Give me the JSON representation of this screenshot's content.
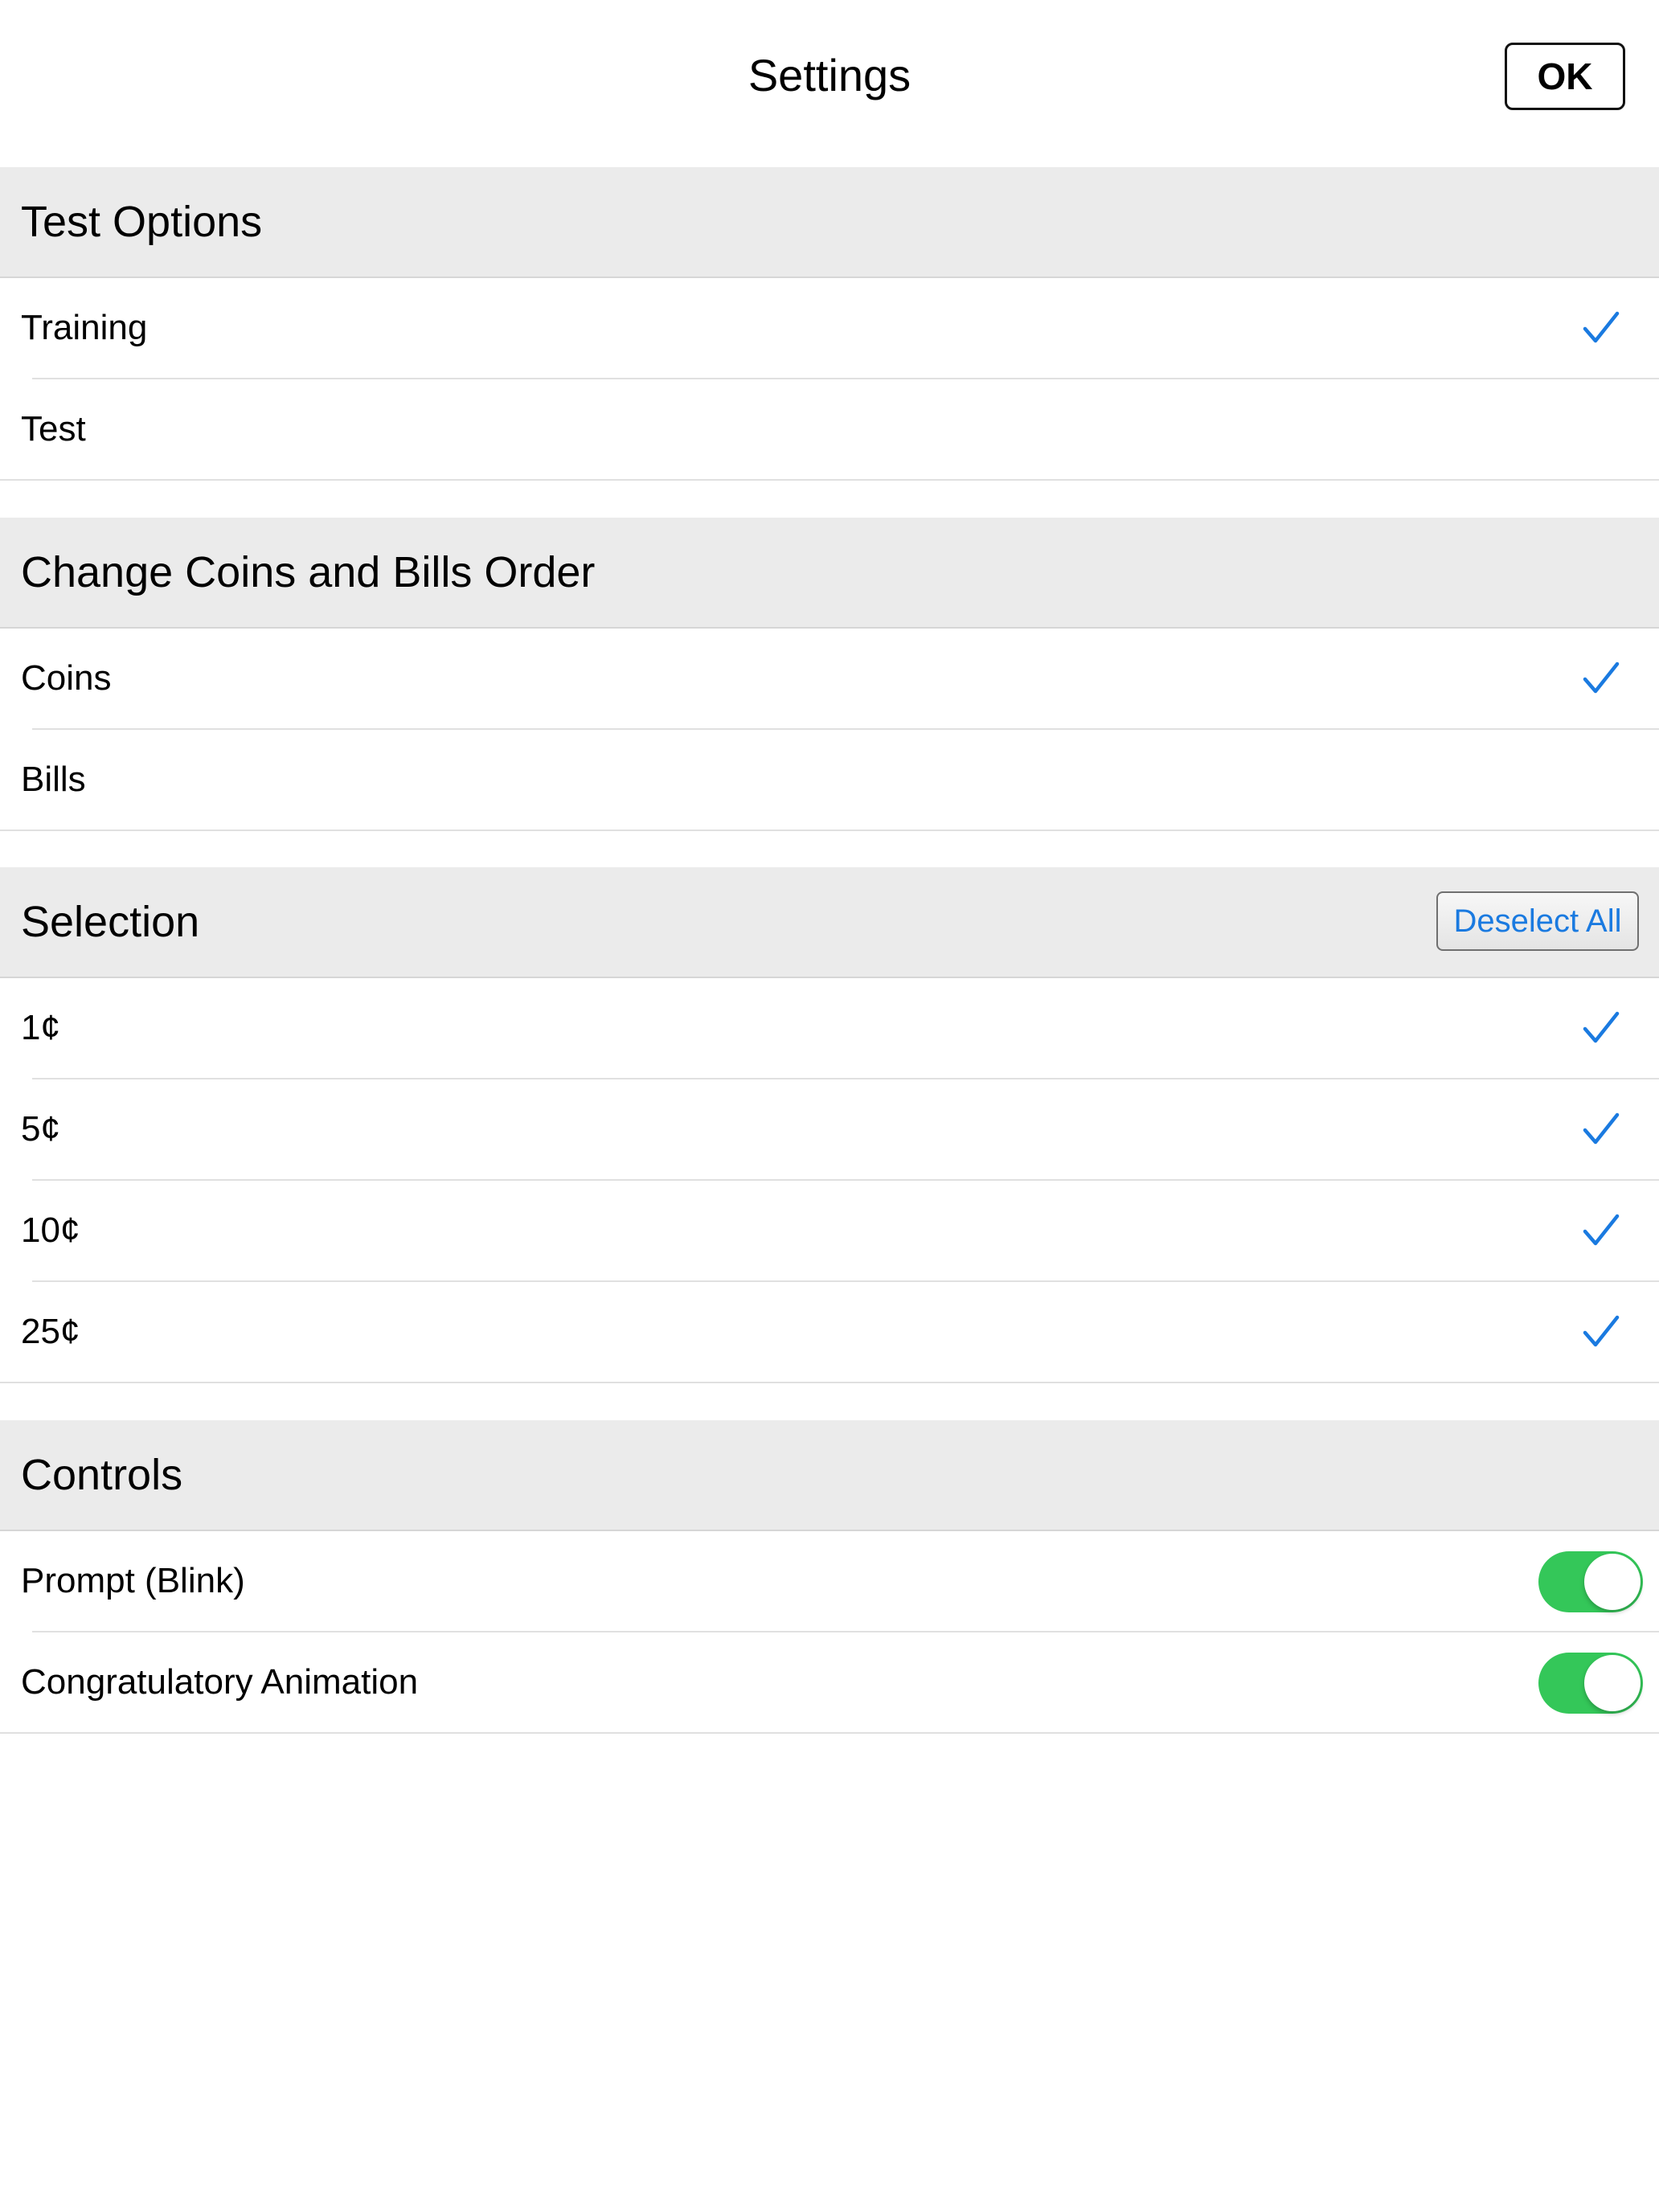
{
  "header": {
    "title": "Settings",
    "ok_label": "OK"
  },
  "sections": {
    "test_options": {
      "title": "Test Options",
      "rows": [
        {
          "label": "Training",
          "checked": true
        },
        {
          "label": "Test",
          "checked": false
        }
      ]
    },
    "order": {
      "title": "Change Coins and Bills Order",
      "rows": [
        {
          "label": "Coins",
          "checked": true
        },
        {
          "label": "Bills",
          "checked": false
        }
      ]
    },
    "selection": {
      "title": "Selection",
      "deselect_label": "Deselect All",
      "rows": [
        {
          "label": "1¢",
          "checked": true
        },
        {
          "label": "5¢",
          "checked": true
        },
        {
          "label": "10¢",
          "checked": true
        },
        {
          "label": "25¢",
          "checked": true
        }
      ]
    },
    "controls": {
      "title": "Controls",
      "rows": [
        {
          "label": "Prompt (Blink)",
          "on": true
        },
        {
          "label": "Congratulatory Animation",
          "on": true
        }
      ]
    }
  },
  "colors": {
    "accent": "#1a7ae0",
    "toggle_on": "#34c759",
    "section_bg": "#ebebeb"
  },
  "icons": {
    "checkmark": "checkmark-icon"
  }
}
